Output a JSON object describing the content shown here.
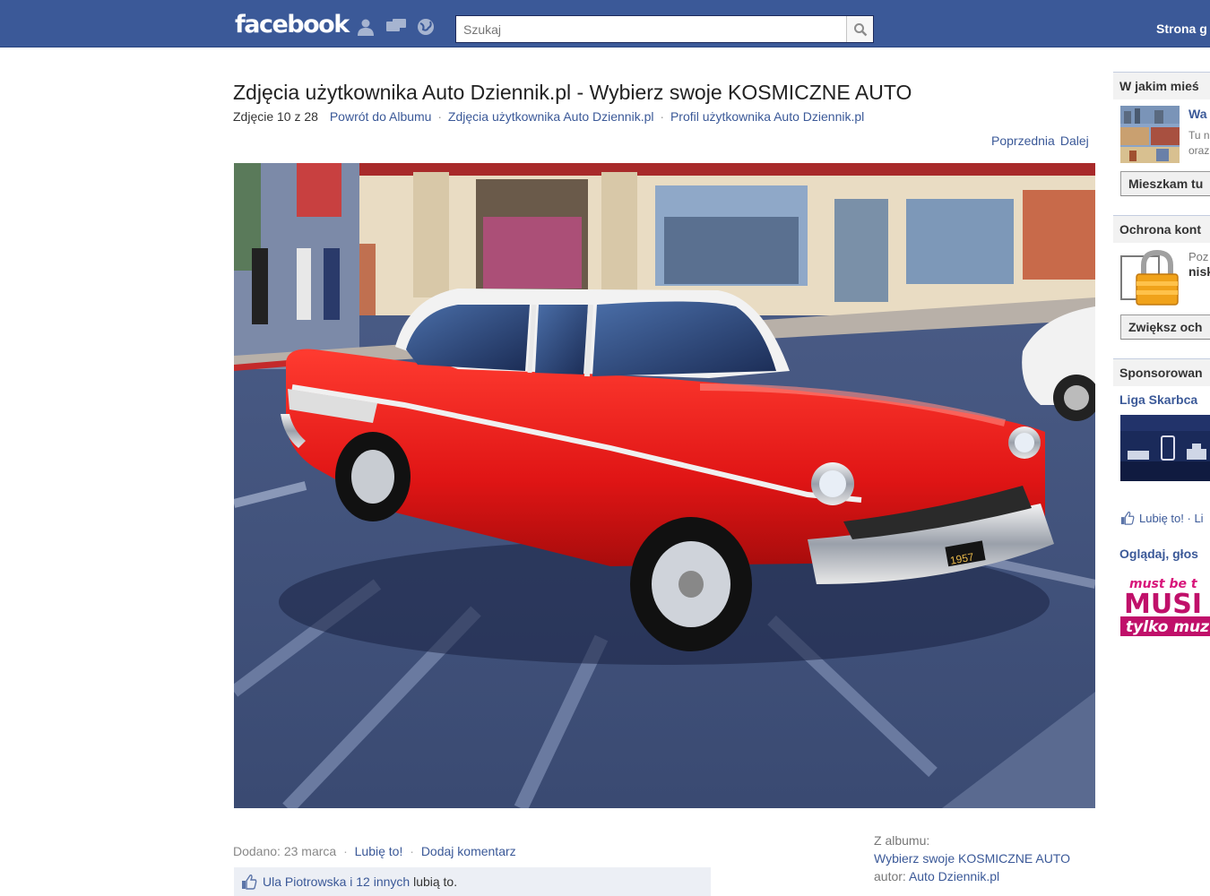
{
  "topbar": {
    "logo": "facebook",
    "search_placeholder": "Szukaj",
    "home_label": "Strona g"
  },
  "photo_page": {
    "title": "Zdjęcia użytkownika Auto Dziennik.pl - Wybierz swoje KOSMICZNE AUTO",
    "counter": "Zdjęcie 10 z 28",
    "breadcrumbs": [
      "Powrót do Albumu",
      "Zdjęcia użytkownika Auto Dziennik.pl",
      "Profil użytkownika Auto Dziennik.pl"
    ],
    "prev_label": "Poprzednia",
    "next_label": "Dalej",
    "photo_alt": "Czerwony Chevrolet Bel Air 1957",
    "plate": "1957",
    "added": "Dodano: 23 marca",
    "like_label": "Lubię to!",
    "comment_label": "Dodaj komentarz",
    "likes": {
      "names": "Ula Piotrowska i 12 innych",
      "suffix": "lubią to."
    },
    "album": {
      "from_label": "Z albumu:",
      "name": "Wybierz swoje KOSMICZNE AUTO",
      "author_label": "autor:",
      "author": "Auto Dziennik.pl"
    }
  },
  "sidebar": {
    "location_head": "W jakim mieś",
    "location_title": "Wa",
    "location_text1": "Tu n",
    "location_text2": "oraz",
    "location_button": "Mieszkam tu",
    "security_head": "Ochrona kont",
    "security_text1": "Poz",
    "security_text2": "nisk",
    "security_button": "Zwiększ och",
    "sponsored_head": "Sponsorowan",
    "ad1_title": "Liga Skarbca",
    "ad1_like": "Lubię to!",
    "ad1_more": "Li",
    "ad2_title": "Oglądaj, głos",
    "ad2_banner_top": "must be t",
    "ad2_banner_mid": "MUSI",
    "ad2_banner_bot": "tylko muz"
  },
  "colors": {
    "brand_blue": "#3b5998",
    "car_red": "#e32222"
  }
}
